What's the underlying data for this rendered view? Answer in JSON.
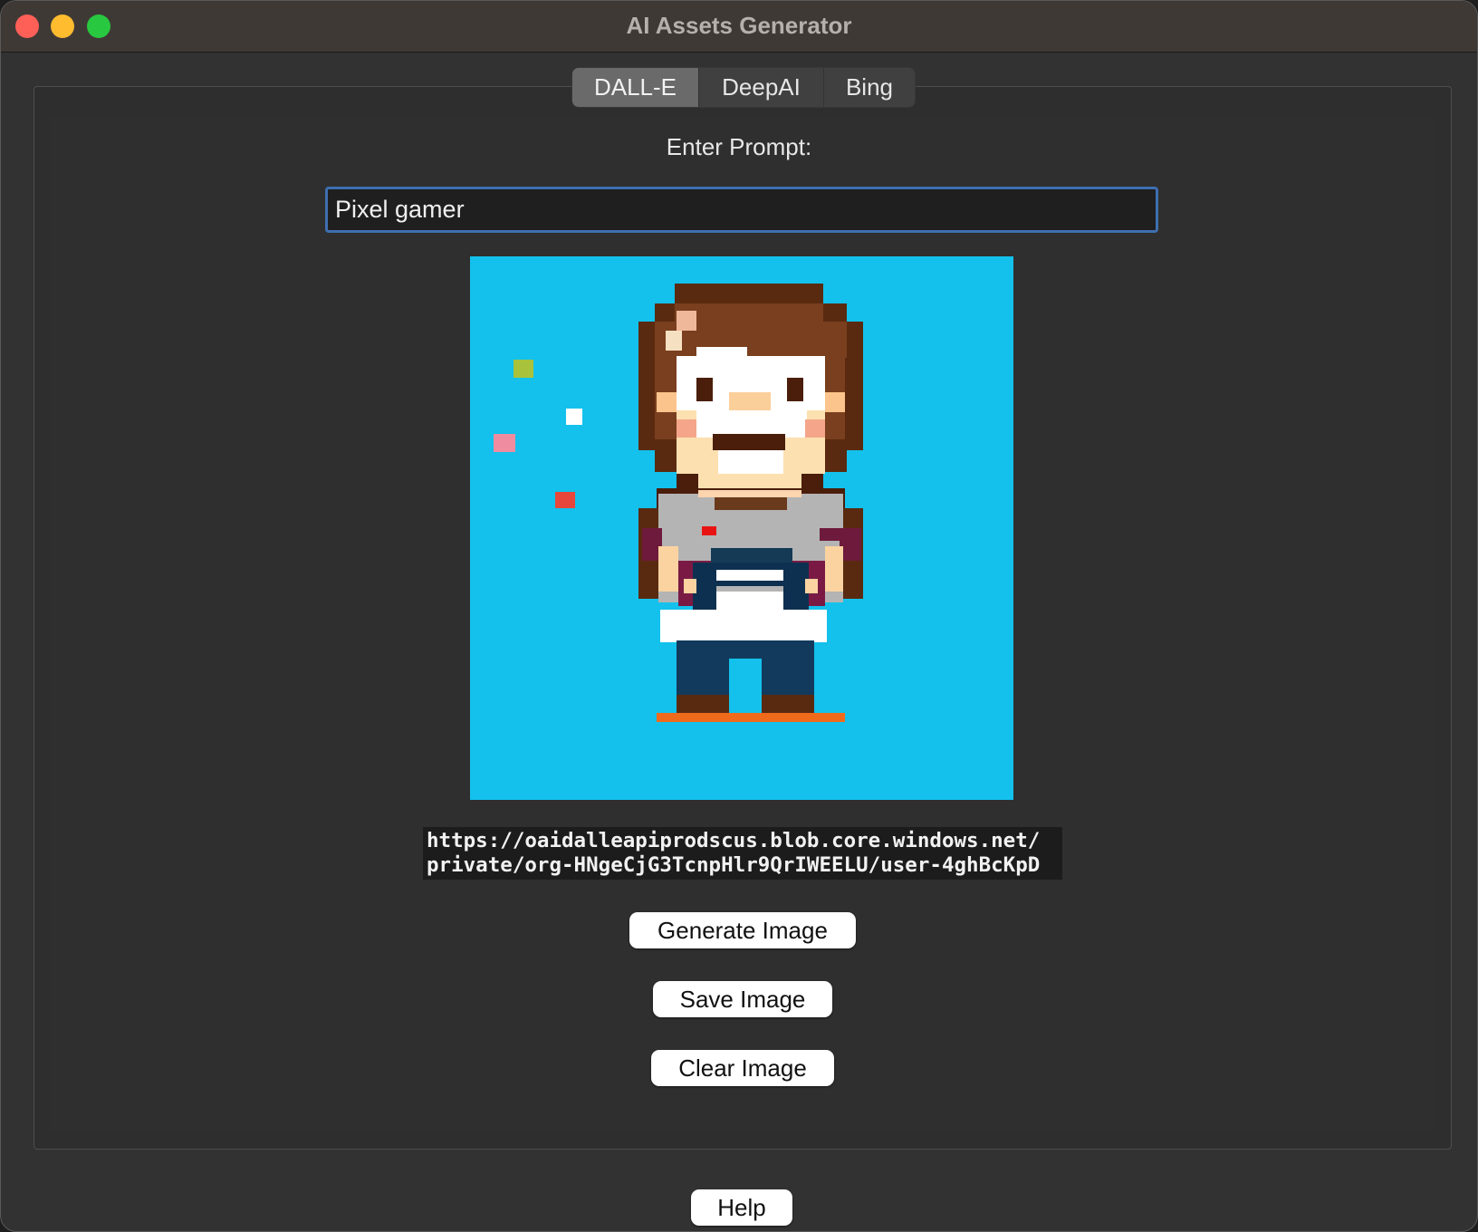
{
  "window": {
    "title": "AI Assets Generator"
  },
  "tabs": [
    {
      "label": "DALL-E",
      "active": true
    },
    {
      "label": "DeepAI",
      "active": false
    },
    {
      "label": "Bing",
      "active": false
    }
  ],
  "prompt": {
    "label": "Enter Prompt:",
    "value": "Pixel gamer"
  },
  "image": {
    "url_line1": "https://oaidalleapiprodscus.blob.core.windows.net/",
    "url_line2": "private/org-HNgeCjG3TcnpHlr9QrIWEELU/user-4ghBcKpD"
  },
  "buttons": {
    "generate": "Generate Image",
    "save": "Save Image",
    "clear": "Clear Image",
    "help": "Help"
  },
  "colors": {
    "accent": "#3e6fb0",
    "image_background": "#13c1ec"
  }
}
